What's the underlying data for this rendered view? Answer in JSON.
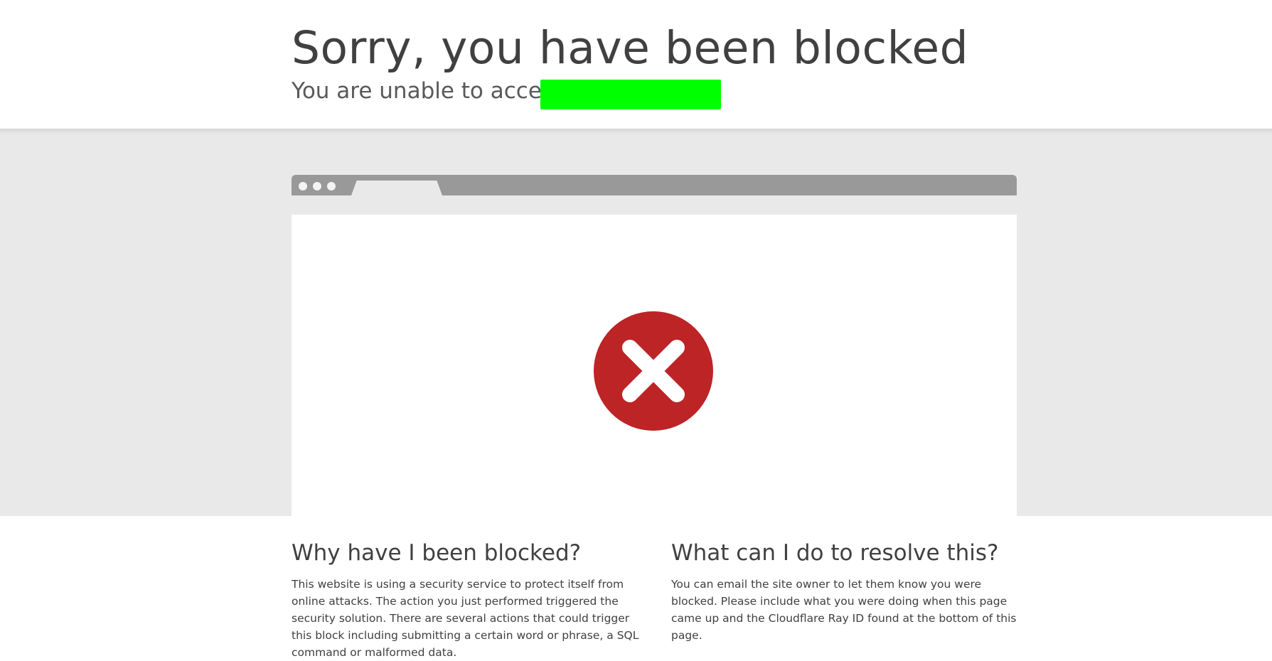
{
  "header": {
    "title": "Sorry, you have been blocked",
    "subtitle": "You are unable to access",
    "redaction_color": "#00ff00"
  },
  "illustration": {
    "browser_bar_color": "#999999",
    "error_icon": "x-circle-icon",
    "error_color": "#bd2426"
  },
  "why_section": {
    "heading": "Why have I been blocked?",
    "body": "This website is using a security service to protect itself from online attacks. The action you just performed triggered the security solution. There are several actions that could trigger this block including submitting a certain word or phrase, a SQL command or malformed data."
  },
  "resolve_section": {
    "heading": "What can I do to resolve this?",
    "body": "You can email the site owner to let them know you were blocked. Please include what you were doing when this page came up and the Cloudflare Ray ID found at the bottom of this page."
  }
}
